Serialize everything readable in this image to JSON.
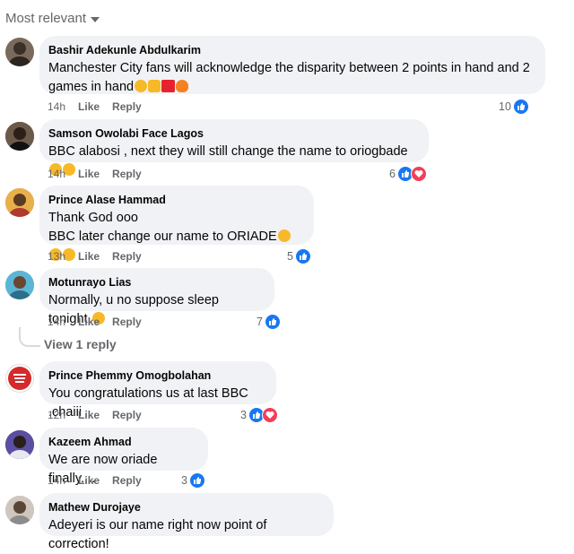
{
  "sort_label": "Most relevant",
  "colors": {
    "bubble": "#f0f2f5",
    "like": "#1877f2",
    "love": "#f33e58",
    "meta": "#65676b"
  },
  "comments": [
    {
      "author": "Bashir Adekunle Abdulkarim",
      "lines": [
        "Manchester City fans will acknowledge the disparity between 2 points in hand and 2",
        "games in hand"
      ],
      "time": "14h",
      "like": "Like",
      "reply": "Reply",
      "reactions": "10",
      "emojis": [
        "laugh-cry",
        "clap",
        "hundred",
        "fire"
      ]
    },
    {
      "author": "Samson Owolabi Face Lagos",
      "lines": [
        "BBC alabosi , next they will still change the name to oriogbade"
      ],
      "time": "14h",
      "like": "Like",
      "reply": "Reply",
      "reactions": "6",
      "emojis": [
        "laugh-cry",
        "laugh-cry"
      ]
    },
    {
      "author": "Prince Alase Hammad",
      "lines": [
        "Thank God ooo",
        "BBC later change our name to ORIADE"
      ],
      "time": "13h",
      "like": "Like",
      "reply": "Reply",
      "reactions": "5",
      "emojis": [
        "laugh-cry",
        "laugh-cry",
        "laugh-cry"
      ]
    },
    {
      "author": "Motunrayo Lias",
      "lines": [
        "Normally, u no suppose sleep tonight."
      ],
      "time": "14h",
      "like": "Like",
      "reply": "Reply",
      "reactions": "7",
      "emojis": [
        "persevere"
      ]
    },
    {
      "author": "Prince Phemmy Omogbolahan",
      "lines": [
        "You congratulations us at last BBC .chaiii"
      ],
      "time": "12h",
      "like": "Like",
      "reply": "Reply",
      "reactions": "3"
    },
    {
      "author": "Kazeem Ahmad",
      "lines": [
        "We are now oriade finally...."
      ],
      "time": "14h",
      "like": "Like",
      "reply": "Reply",
      "reactions": "3"
    },
    {
      "author": "Mathew Durojaye",
      "lines": [
        "Adeyeri is our name right now point of correction!"
      ]
    }
  ],
  "view_replies": "View 1 reply"
}
